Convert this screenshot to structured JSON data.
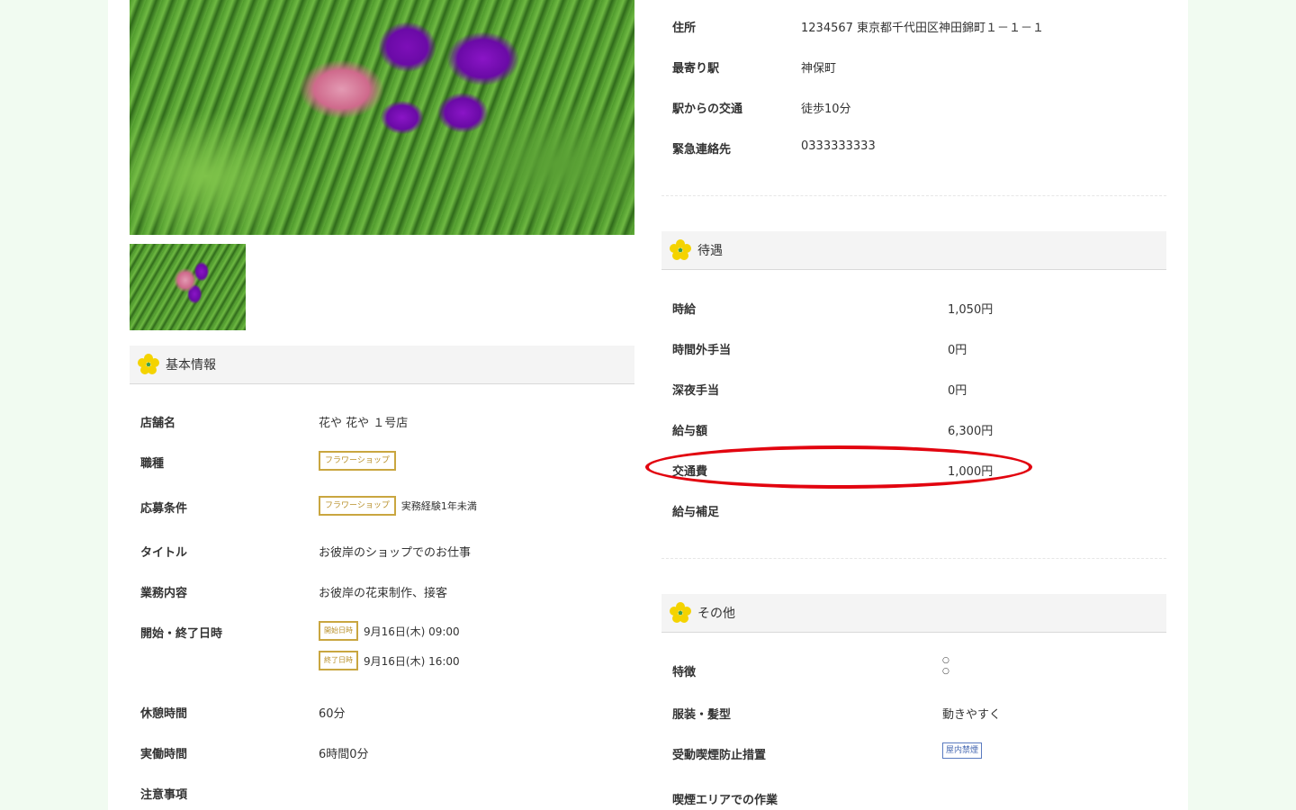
{
  "images": {
    "hero_icon": "flower-photo",
    "thumb_icon": "flower-photo"
  },
  "basic": {
    "title": "基本情報",
    "shop_name_label": "店舗名",
    "shop_name_value": "花や 花や １号店",
    "job_type_label": "職種",
    "job_type_tag": "フラワーショップ",
    "conditions_label": "応募条件",
    "conditions_tag": "フラワーショップ",
    "conditions_text": "実務経験1年未満",
    "job_title_label": "タイトル",
    "job_title_value": "お彼岸のショップでのお仕事",
    "duties_label": "業務内容",
    "duties_value": "お彼岸の花束制作、接客",
    "datetime_label": "開始・終了日時",
    "start_tag": "開始日時",
    "start_value": "9月16日(木) 09:00",
    "end_tag": "終了日時",
    "end_value": "9月16日(木) 16:00",
    "break_label": "休憩時間",
    "break_value": "60分",
    "work_label": "実働時間",
    "work_value": "6時間0分",
    "notes_label": "注意事項"
  },
  "access": {
    "address_label": "住所",
    "address_value": "1234567 東京都千代田区神田錦町１－１－１",
    "station_label": "最寄り駅",
    "station_value": "神保町",
    "transit_label": "駅からの交通",
    "transit_value": "徒歩10分",
    "emergency_label": "緊急連絡先",
    "emergency_value": "0333333333"
  },
  "pay": {
    "title": "待遇",
    "hourly_label": "時給",
    "hourly_value": "1,050円",
    "overtime_label": "時間外手当",
    "overtime_value": "0円",
    "night_label": "深夜手当",
    "night_value": "0円",
    "salary_label": "給与額",
    "salary_value": "6,300円",
    "transport_label": "交通費",
    "transport_value": "1,000円",
    "supplement_label": "給与補足"
  },
  "other": {
    "title": "その他",
    "features_label": "特徴",
    "features_items": [
      "○",
      "○"
    ],
    "dress_label": "服装・髪型",
    "dress_value": "動きやすく",
    "smoking_label": "受動喫煙防止措置",
    "smoking_tag": "屋内禁煙",
    "smoking_area_label": "喫煙エリアでの作業"
  },
  "colors": {
    "page_bg": "#f1fbf1",
    "tag_gold": "#c9a640",
    "tag_blue": "#5a7bc0",
    "highlight_red": "#e2040f"
  }
}
